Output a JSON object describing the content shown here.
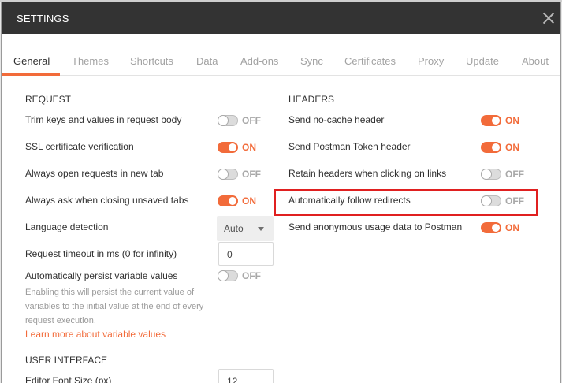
{
  "window": {
    "title": "SETTINGS"
  },
  "tabs": [
    {
      "label": "General"
    },
    {
      "label": "Themes"
    },
    {
      "label": "Shortcuts"
    },
    {
      "label": "Data"
    },
    {
      "label": "Add-ons"
    },
    {
      "label": "Sync"
    },
    {
      "label": "Certificates"
    },
    {
      "label": "Proxy"
    },
    {
      "label": "Update"
    },
    {
      "label": "About"
    }
  ],
  "request": {
    "title": "REQUEST",
    "trim_keys": {
      "label": "Trim keys and values in request body",
      "state": "OFF"
    },
    "ssl": {
      "label": "SSL certificate verification",
      "state": "ON"
    },
    "new_tab": {
      "label": "Always open requests in new tab",
      "state": "OFF"
    },
    "ask_closing": {
      "label": "Always ask when closing unsaved tabs",
      "state": "ON"
    },
    "language": {
      "label": "Language detection",
      "value": "Auto"
    },
    "timeout": {
      "label": "Request timeout in ms (0 for infinity)",
      "value": "0"
    },
    "persist": {
      "label": "Automatically persist variable values",
      "state": "OFF",
      "help": "Enabling this will persist the current value of variables to the initial value at the end of every request execution.",
      "link": "Learn more about variable values"
    }
  },
  "ui": {
    "title": "USER INTERFACE",
    "font_size": {
      "label": "Editor Font Size (px)",
      "value": "12"
    }
  },
  "headers": {
    "title": "HEADERS",
    "no_cache": {
      "label": "Send no-cache header",
      "state": "ON"
    },
    "postman_token": {
      "label": "Send Postman Token header",
      "state": "ON"
    },
    "retain": {
      "label": "Retain headers when clicking on links",
      "state": "OFF"
    },
    "redirects": {
      "label": "Automatically follow redirects",
      "state": "OFF"
    },
    "usage": {
      "label": "Send anonymous usage data to Postman",
      "state": "ON"
    }
  },
  "colors": {
    "accent": "#f26b3a",
    "titlebar": "#333333",
    "highlight": "#e02020"
  }
}
